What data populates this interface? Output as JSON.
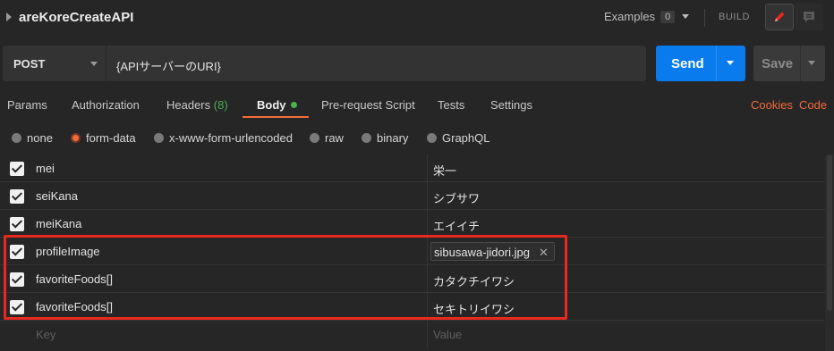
{
  "header": {
    "request_name": "areKoreCreateAPI",
    "examples_label": "Examples",
    "examples_count": "0",
    "build_label": "BUILD"
  },
  "request": {
    "method": "POST",
    "url": "{APIサーバーのURI}",
    "send_label": "Send",
    "save_label": "Save"
  },
  "tabs": {
    "params": "Params",
    "authorization": "Authorization",
    "headers": "Headers",
    "headers_count": "(8)",
    "body": "Body",
    "prerequest": "Pre-request Script",
    "tests": "Tests",
    "settings": "Settings",
    "cookies": "Cookies",
    "code": "Code"
  },
  "body_types": [
    "none",
    "form-data",
    "x-www-form-urlencoded",
    "raw",
    "binary",
    "GraphQL"
  ],
  "body_type_selected": "form-data",
  "form_rows": [
    {
      "key": "mei",
      "value": "栄一",
      "checked": true
    },
    {
      "key": "seiKana",
      "value": "シブサワ",
      "checked": true
    },
    {
      "key": "meiKana",
      "value": "エイイチ",
      "checked": true
    },
    {
      "key": "profileImage",
      "value": "sibusawa-jidori.jpg",
      "checked": true,
      "is_file": true
    },
    {
      "key": "favoriteFoods[]",
      "value": "カタクチイワシ",
      "checked": true
    },
    {
      "key": "favoriteFoods[]",
      "value": "セキトリイワシ",
      "checked": true
    }
  ],
  "new_row": {
    "key_placeholder": "Key",
    "value_placeholder": "Value"
  },
  "colors": {
    "accent": "#f26b3a",
    "send": "#097bed",
    "highlight": "#e9291f",
    "active_dot": "#4caf50"
  }
}
